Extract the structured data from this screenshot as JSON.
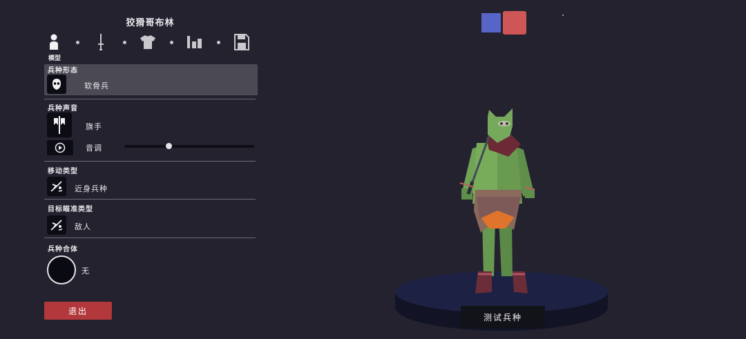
{
  "unit_name": "狡猾哥布林",
  "tabs": {
    "active_caption": "模型",
    "items": [
      {
        "icon": "person-icon"
      },
      {
        "icon": "sword-icon"
      },
      {
        "icon": "shirt-icon"
      },
      {
        "icon": "bar-chart-icon"
      },
      {
        "icon": "save-icon"
      }
    ]
  },
  "sections": {
    "form": {
      "title": "兵种形态",
      "value": "软骨兵",
      "icon": "skull-mask-icon"
    },
    "voice": {
      "title": "兵种声音",
      "value": "旗手",
      "icon": "banner-icon",
      "pitch_label": "音调",
      "pitch_level": 0.34
    },
    "movement": {
      "title": "移动类型",
      "value": "近身兵种",
      "icon": "melee-icon"
    },
    "targeting": {
      "title": "目标瞄准类型",
      "value": "敌人",
      "icon": "target-enemy-icon"
    },
    "combine": {
      "title": "兵种合体",
      "value": "无"
    }
  },
  "exit_label": "退出",
  "test_label": "测试兵种",
  "team_colors": [
    "#5865c8",
    "#cf5656"
  ]
}
